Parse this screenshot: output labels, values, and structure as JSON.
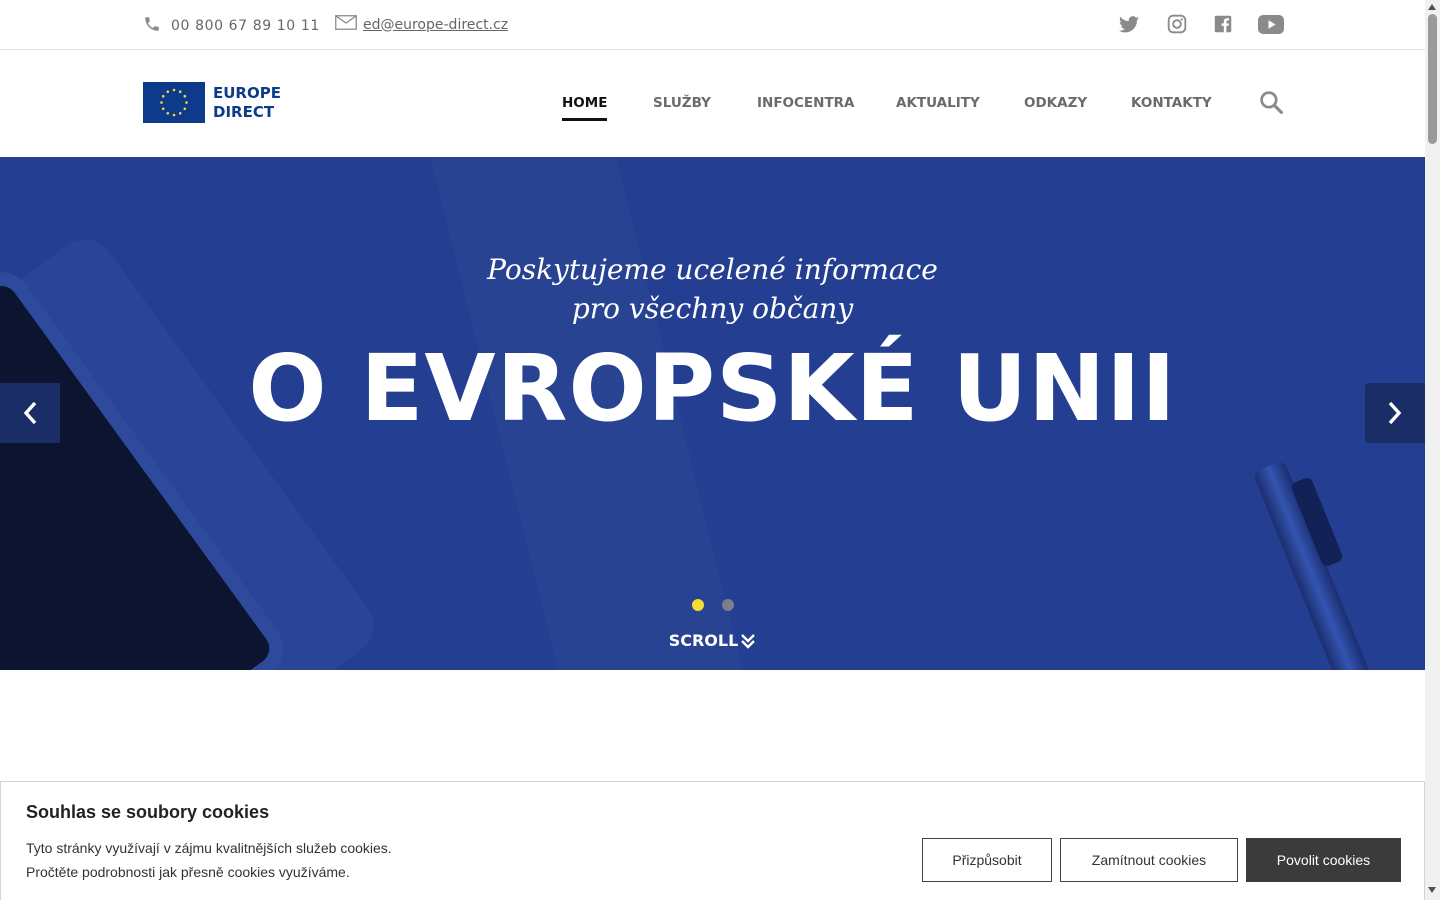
{
  "topbar": {
    "phone": "00 800 67 89 10 11",
    "email": "ed@europe-direct.cz",
    "social": [
      "twitter-icon",
      "instagram-icon",
      "facebook-icon",
      "youtube-icon"
    ]
  },
  "logo": {
    "line1": "EUROPE",
    "line2": "DIRECT"
  },
  "nav": {
    "items": [
      {
        "label": "HOME",
        "active": true
      },
      {
        "label": "SLUŽBY"
      },
      {
        "label": "INFOCENTRA"
      },
      {
        "label": "AKTUALITY"
      },
      {
        "label": "ODKAZY"
      },
      {
        "label": "KONTAKTY"
      }
    ]
  },
  "hero": {
    "subtitle_line1": "Poskytujeme ucelené informace",
    "subtitle_line2": "pro všechny občany",
    "headline": "O EVROPSKÉ UNII",
    "scroll_label": "SCROLL",
    "active_slide": 1,
    "slide_count": 2
  },
  "cookie": {
    "title": "Souhlas se soubory cookies",
    "line1": "Tyto stránky využívají v zájmu kvalitnějších služeb cookies.",
    "line2": "Pročtěte podrobnosti jak přesně cookies využíváme.",
    "customize": "Přizpůsobit",
    "reject": "Zamítnout cookies",
    "accept": "Povolit cookies"
  },
  "colors": {
    "hero_bg": "#243f91",
    "eu_blue": "#0e3a8c",
    "eu_yellow": "#f2dd35",
    "accept_button": "#3b3b3b"
  }
}
